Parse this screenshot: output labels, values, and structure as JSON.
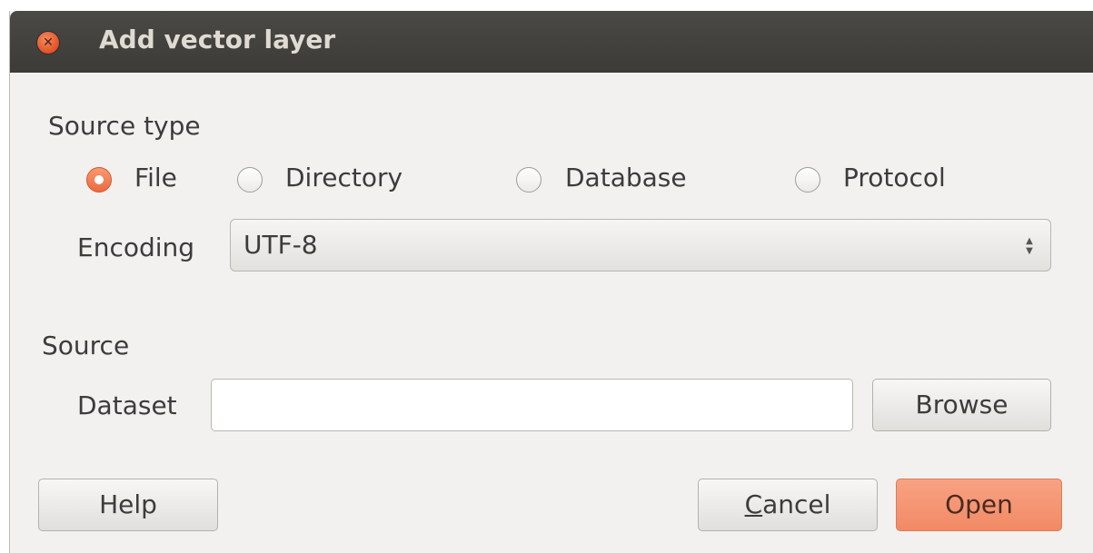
{
  "window": {
    "title": "Add vector layer"
  },
  "source_type": {
    "heading": "Source type",
    "options": [
      {
        "label": "File",
        "selected": true
      },
      {
        "label": "Directory",
        "selected": false
      },
      {
        "label": "Database",
        "selected": false
      },
      {
        "label": "Protocol",
        "selected": false
      }
    ],
    "encoding_label": "Encoding",
    "encoding_value": "UTF-8"
  },
  "source": {
    "heading": "Source",
    "dataset_label": "Dataset",
    "dataset_value": "",
    "browse_label": "Browse"
  },
  "buttons": {
    "help": "Help",
    "cancel_mnemonic": "C",
    "cancel_rest": "ancel",
    "open": "Open"
  },
  "colors": {
    "accent": "#f28a65",
    "titlebar": "#3c3b37",
    "window_bg": "#f2f1f0"
  },
  "icons": {
    "close": "close-icon",
    "combo": "up-down-arrows-icon"
  }
}
